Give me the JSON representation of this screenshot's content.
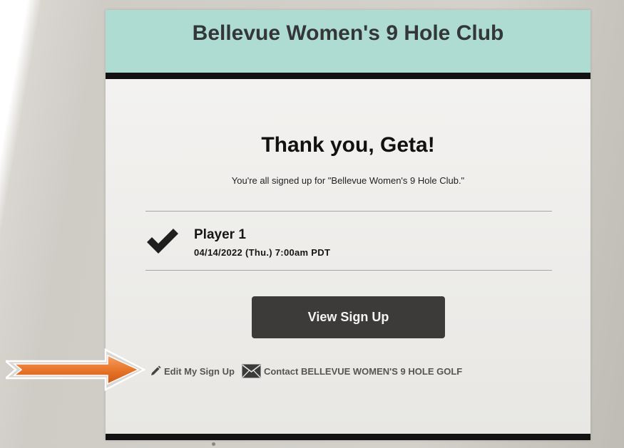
{
  "header": {
    "club_title": "Bellevue Women's 9 Hole Club"
  },
  "confirmation": {
    "heading": "Thank you, Geta!",
    "message": "You're all signed up for \"Bellevue Women's 9 Hole Club.\""
  },
  "slot": {
    "icon": "checkmark-icon",
    "player_label": "Player 1",
    "datetime": "04/14/2022 (Thu.) 7:00am PDT"
  },
  "actions": {
    "view_label": "View Sign Up",
    "edit_label": "Edit My Sign Up",
    "edit_icon": "pencil-icon",
    "contact_label": "Contact BELLEVUE WOMEN'S 9 HOLE GOLF",
    "contact_icon": "envelope-icon"
  },
  "colors": {
    "header_band": "#aedcd2",
    "button": "#3d3b39",
    "arrow": "#e8762b"
  }
}
